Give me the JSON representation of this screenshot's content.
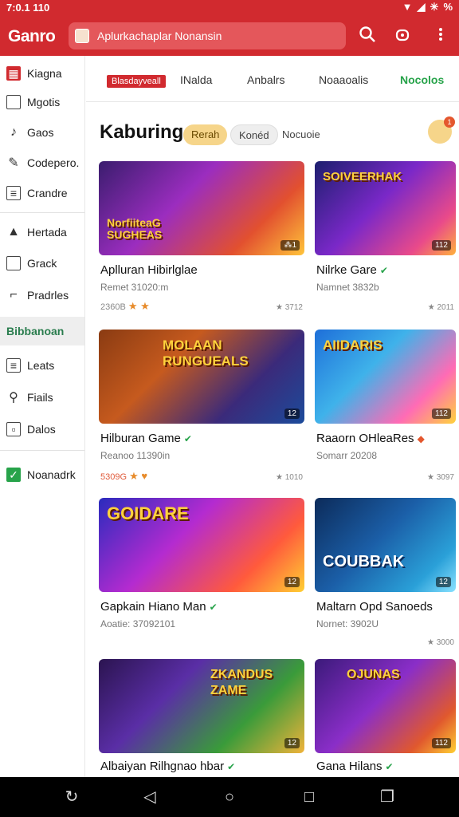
{
  "status": {
    "time": "7:0.1 110",
    "icons": [
      "▼",
      "◢",
      "✳",
      "%"
    ]
  },
  "appbar": {
    "brand": "Ganro",
    "search_text": "Aplurkachaplar Nonansin",
    "icons": {
      "search": "search-icon",
      "game": "gamepad-icon",
      "more": "more-icon"
    }
  },
  "sidebar": {
    "items": [
      {
        "label": "Kiagna",
        "icon": "home-icon"
      },
      {
        "label": "Mgotis",
        "icon": "window-icon"
      },
      {
        "label": "Gaos",
        "icon": "game-icon"
      },
      {
        "label": "Codepero.",
        "icon": "pen-icon"
      },
      {
        "label": "Crandre",
        "icon": "list-icon"
      },
      {
        "label": "Hertada",
        "icon": "triangle-icon"
      },
      {
        "label": "Grack",
        "icon": "card-icon"
      },
      {
        "label": "Pradrles",
        "icon": "folder-icon"
      },
      {
        "label": "Bibbanoan",
        "icon": ""
      },
      {
        "label": "Leats",
        "icon": "doc-icon"
      },
      {
        "label": "Fiails",
        "icon": "search-icon"
      },
      {
        "label": "Dalos",
        "icon": "box-icon"
      },
      {
        "label": "Noanadrk",
        "icon": "check-icon"
      }
    ]
  },
  "tabs": [
    "Blasdayveall",
    "INalda",
    "Anbalrs",
    "Noaaoalis",
    "Nocolos"
  ],
  "section": {
    "title": "Kaburing",
    "chips": [
      "Rerah",
      "Konéd",
      "Nocuoie"
    ],
    "notify_count": "1"
  },
  "cards": [
    {
      "art": "NorfiiteaG\nSUGHEAS",
      "badge": "⁂1",
      "title": "Aplluran Hibirlglae",
      "verified": false,
      "sub": "Remet 31020:m",
      "meta": "2360B",
      "rating": "★ 3712"
    },
    {
      "art": "SOIVEERHAK",
      "badge": "112",
      "title": "Nilrke Gare",
      "verified": true,
      "sub": "Namnet 3832b",
      "meta": "",
      "rating": "★ 2011"
    },
    {
      "art": "MOLAAN\nRUNGUEALS",
      "badge": "12",
      "title": "Hilburan Game",
      "verified": true,
      "sub": "Reanoo 11390in",
      "meta": "5309G",
      "rating": "★ 1010"
    },
    {
      "art": "AIIDARIS",
      "badge": "112",
      "title": "Raaorn OHleaRes",
      "verified": true,
      "sub": "Somarr 20208",
      "meta": "",
      "rating": "★ 3097"
    },
    {
      "art": "GOIDARE",
      "badge": "12",
      "title": "Gapkain Hiano Man",
      "verified": true,
      "sub": "Aoatie: 37092101",
      "meta": "",
      "rating": ""
    },
    {
      "art": "COUBBAK",
      "badge": "12",
      "title": "Maltarn Opd Sanoeds",
      "verified": false,
      "sub": "Nornet: 3902U",
      "meta": "",
      "rating": "★ 3000"
    },
    {
      "art": "ZKANDUS\nZAME",
      "badge": "12",
      "title": "Albaiyan Rilhgnao hbar",
      "verified": true,
      "sub": "",
      "meta": "",
      "rating": ""
    },
    {
      "art": "OJUNAS",
      "badge": "112",
      "title": "Gana Hilans",
      "verified": true,
      "sub": "",
      "meta": "",
      "rating": ""
    }
  ],
  "navbar": {
    "icons": [
      "refresh-icon",
      "back-icon",
      "home-icon",
      "recents-icon",
      "copy-icon"
    ]
  }
}
